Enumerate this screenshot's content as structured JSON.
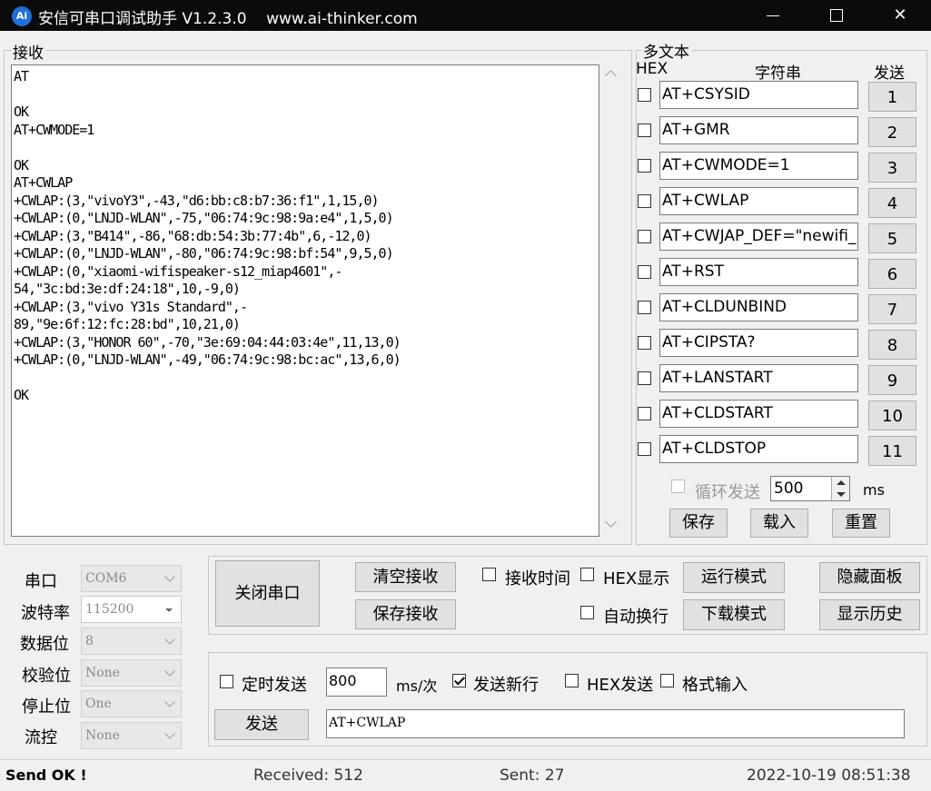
{
  "window": {
    "title": "安信可串口调试助手 V1.2.3.0    www.ai-thinker.com",
    "icon_text": "Ai",
    "minimize": "—",
    "close": "✕"
  },
  "receive": {
    "group_title": "接收",
    "text": "AT\n\nOK\nAT+CWMODE=1\n\nOK\nAT+CWLAP\n+CWLAP:(3,\"vivoY3\",-43,\"d6:bb:c8:b7:36:f1\",1,15,0)\n+CWLAP:(0,\"LNJD-WLAN\",-75,\"06:74:9c:98:9a:e4\",1,5,0)\n+CWLAP:(3,\"B414\",-86,\"68:db:54:3b:77:4b\",6,-12,0)\n+CWLAP:(0,\"LNJD-WLAN\",-80,\"06:74:9c:98:bf:54\",9,5,0)\n+CWLAP:(0,\"xiaomi-wifispeaker-s12_miap4601\",-\n54,\"3c:bd:3e:df:24:18\",10,-9,0)\n+CWLAP:(3,\"vivo Y31s Standard\",-\n89,\"9e:6f:12:fc:28:bd\",10,21,0)\n+CWLAP:(3,\"HONOR 60\",-70,\"3e:69:04:44:03:4e\",11,13,0)\n+CWLAP:(0,\"LNJD-WLAN\",-49,\"06:74:9c:98:bc:ac\",13,6,0)\n\nOK"
  },
  "multi": {
    "group_title": "多文本",
    "col_hex": "HEX",
    "col_string": "字符串",
    "col_send": "发送",
    "rows": [
      {
        "text": "AT+CSYSID",
        "num": "1"
      },
      {
        "text": "AT+GMR",
        "num": "2"
      },
      {
        "text": "AT+CWMODE=1",
        "num": "3"
      },
      {
        "text": "AT+CWLAP",
        "num": "4"
      },
      {
        "text": "AT+CWJAP_DEF=\"newifi_",
        "num": "5"
      },
      {
        "text": "AT+RST",
        "num": "6"
      },
      {
        "text": "AT+CLDUNBIND",
        "num": "7"
      },
      {
        "text": "AT+CIPSTA?",
        "num": "8"
      },
      {
        "text": "AT+LANSTART",
        "num": "9"
      },
      {
        "text": "AT+CLDSTART",
        "num": "10"
      },
      {
        "text": "AT+CLDSTOP",
        "num": "11"
      }
    ],
    "loop_label": "循环发送",
    "interval": "500",
    "ms": "ms",
    "save": "保存",
    "load": "载入",
    "reset": "重置"
  },
  "port": {
    "labels": {
      "port": "串口",
      "baud": "波特率",
      "databits": "数据位",
      "parity": "校验位",
      "stopbits": "停止位",
      "flow": "流控"
    },
    "values": {
      "port": "COM6",
      "baud": "115200",
      "databits": "8",
      "parity": "None",
      "stopbits": "One",
      "flow": "None"
    }
  },
  "controls": {
    "close_port": "关闭串口",
    "clear_recv": "清空接收",
    "save_recv": "保存接收",
    "recv_time": "接收时间",
    "hex_display": "HEX显示",
    "auto_wrap": "自动换行",
    "run_mode": "运行模式",
    "download_mode": "下载模式",
    "hide_panel": "隐藏面板",
    "show_history": "显示历史"
  },
  "send": {
    "timed_send": "定时发送",
    "interval": "800",
    "unit": "ms/次",
    "send_newline": "发送新行",
    "hex_send": "HEX发送",
    "format_input": "格式输入",
    "send_button": "发送",
    "input": "AT+CWLAP"
  },
  "status": {
    "message": "Send OK !",
    "received": "Received: 512",
    "sent": "Sent: 27",
    "datetime": "2022-10-19 08:51:38"
  }
}
